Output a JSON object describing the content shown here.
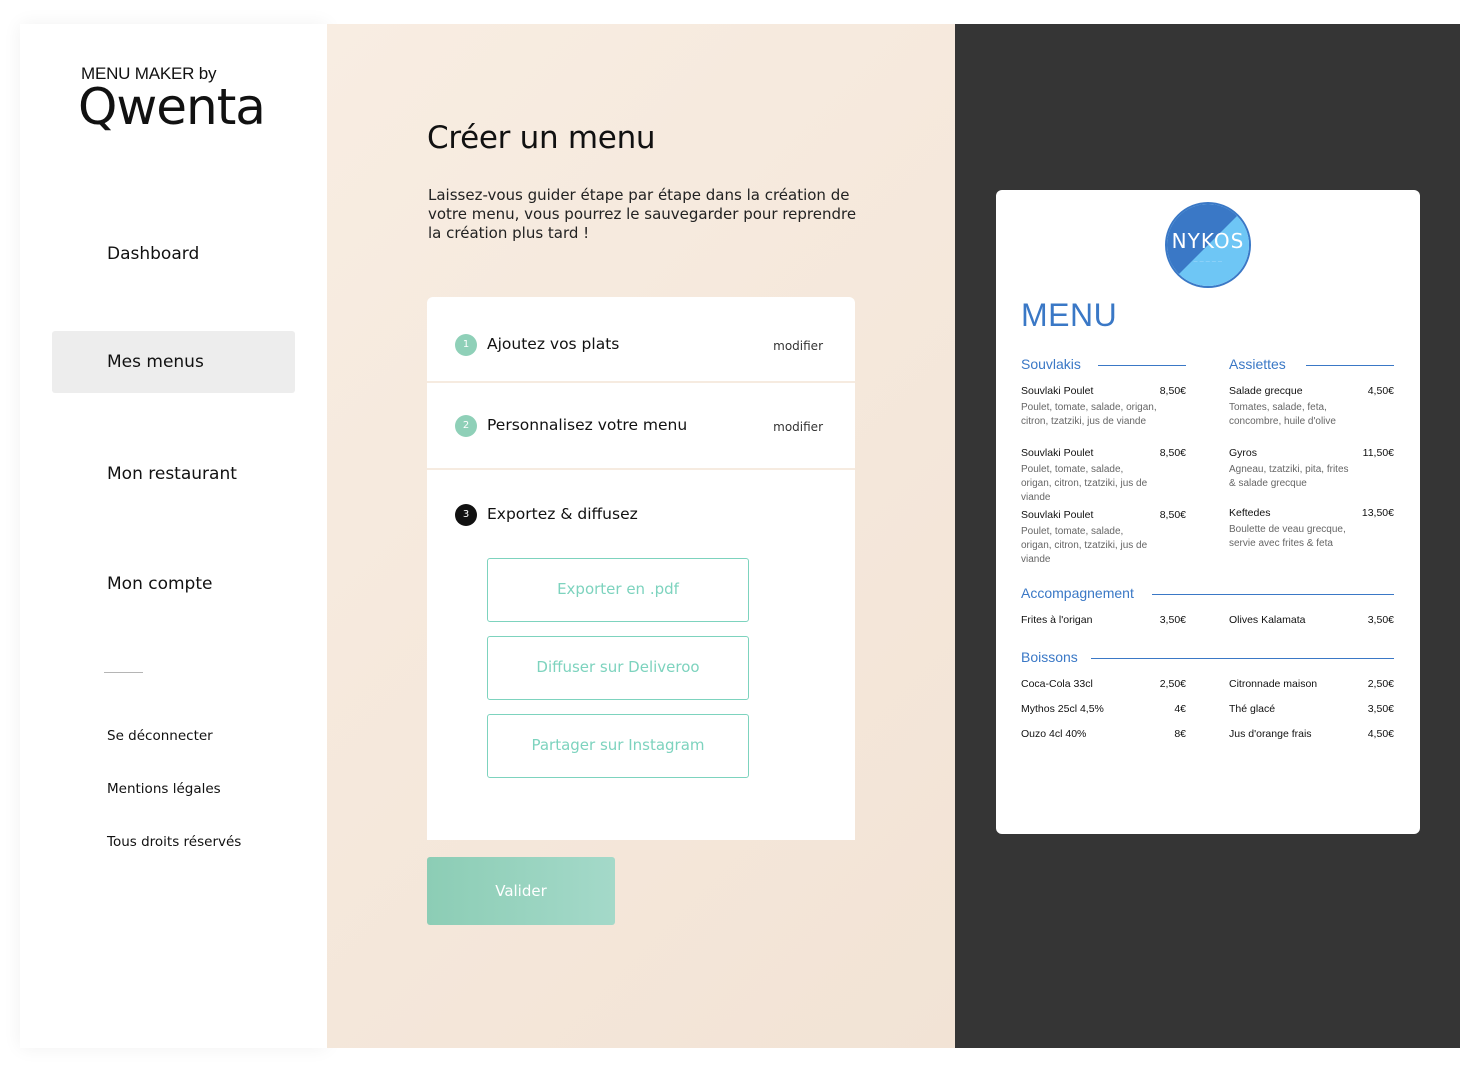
{
  "sidebar": {
    "brand_top": "MENU MAKER by",
    "brand_logo": "Qwenta",
    "nav": [
      {
        "label": "Dashboard",
        "active": false
      },
      {
        "label": "Mes menus",
        "active": true
      },
      {
        "label": "Mon restaurant",
        "active": false
      },
      {
        "label": "Mon compte",
        "active": false
      }
    ],
    "footer_links": [
      "Se déconnecter",
      "Mentions légales",
      "Tous droits réservés"
    ]
  },
  "main": {
    "title": "Créer un menu",
    "description": "Laissez-vous guider étape par étape dans la création de votre menu, vous pourrez le sauvegarder pour reprendre la création plus tard !",
    "steps": [
      {
        "number": "1",
        "label": "Ajoutez vos plats",
        "edit": "modifier",
        "status": "done"
      },
      {
        "number": "2",
        "label": "Personnalisez votre menu",
        "edit": "modifier",
        "status": "done"
      },
      {
        "number": "3",
        "label": "Exportez & diffusez",
        "status": "current"
      }
    ],
    "export_buttons": [
      "Exporter en .pdf",
      "Diffuser sur Deliveroo",
      "Partager sur Instagram"
    ],
    "validate_label": "Valider"
  },
  "preview": {
    "logo_text": "NYKOS",
    "menu_title": "MENU",
    "sections": {
      "souvlakis": {
        "title": "Souvlakis",
        "items": [
          {
            "name": "Souvlaki Poulet",
            "price": "8,50€",
            "desc": "Poulet, tomate, salade, origan, citron, tzatziki, jus de viande"
          },
          {
            "name": "Souvlaki Poulet",
            "price": "8,50€",
            "desc": "Poulet, tomate, salade, origan, citron, tzatziki, jus de viande"
          },
          {
            "name": "Souvlaki Poulet",
            "price": "8,50€",
            "desc": "Poulet, tomate, salade, origan, citron, tzatziki, jus de viande"
          }
        ]
      },
      "assiettes": {
        "title": "Assiettes",
        "items": [
          {
            "name": "Salade grecque",
            "price": "4,50€",
            "desc": "Tomates, salade, feta, concombre, huile d'olive"
          },
          {
            "name": "Gyros",
            "price": "11,50€",
            "desc": "Agneau, tzatziki, pita, frites & salade grecque"
          },
          {
            "name": "Keftedes",
            "price": "13,50€",
            "desc": "Boulette de veau grecque, servie avec frites & feta"
          }
        ]
      },
      "accompagnement": {
        "title": "Accompagnement",
        "items": [
          {
            "name": "Frites à l'origan",
            "price": "3,50€"
          },
          {
            "name": "Olives Kalamata",
            "price": "3,50€"
          }
        ]
      },
      "boissons": {
        "title": "Boissons",
        "items": [
          {
            "name": "Coca-Cola 33cl",
            "price": "2,50€"
          },
          {
            "name": "Citronnade maison",
            "price": "2,50€"
          },
          {
            "name": "Mythos 25cl 4,5%",
            "price": "4€"
          },
          {
            "name": "Thé glacé",
            "price": "3,50€"
          },
          {
            "name": "Ouzo 4cl 40%",
            "price": "8€"
          },
          {
            "name": "Jus d'orange frais",
            "price": "4,50€"
          }
        ]
      }
    },
    "colors": {
      "accent": "#3a78c6",
      "logo_light": "#6ec6f5",
      "teal": "#7dd3be"
    }
  }
}
